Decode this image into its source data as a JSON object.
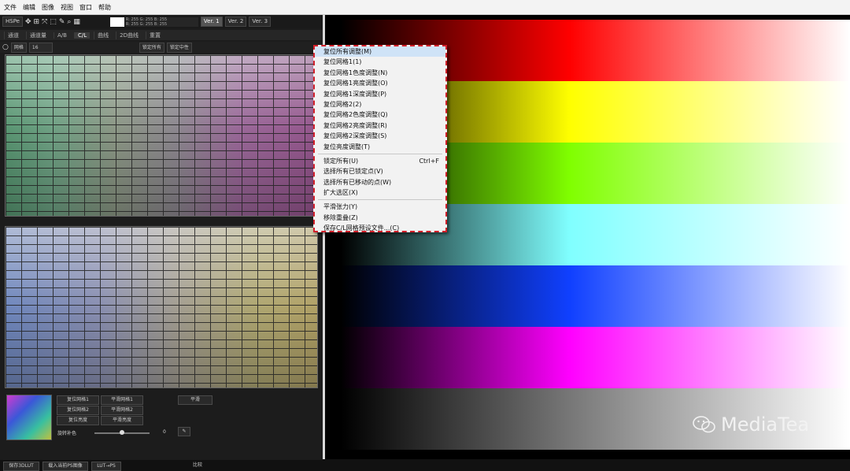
{
  "menubar": [
    "文件",
    "编辑",
    "图像",
    "视图",
    "窗口",
    "帮助"
  ],
  "toolbar": {
    "mode": "HSPe",
    "readout_line1": "R: 255 G: 255 B: 255",
    "readout_line2": "R: 255 G: 255 B: 255",
    "versions": [
      "Ver. 1",
      "Ver. 2",
      "Ver. 3"
    ]
  },
  "tabs": [
    "通道",
    "通道量",
    "A/B",
    "C/L",
    "曲线",
    "2D曲线",
    "重置"
  ],
  "sub": {
    "grid_label": "网格",
    "grid_value": "16",
    "lock_all": "锁定所有",
    "lock_mid": "锁定中性"
  },
  "bottom_buttons": [
    "复位网格1",
    "平滑网格1",
    "平滑",
    "复位网格2",
    "平滑网格2",
    "复位亮度",
    "平滑亮度"
  ],
  "hue_label": "旋转补色",
  "hue_value": "0",
  "footer": [
    "保存3DLUT",
    "载入当前PS图像",
    "LUT→PS",
    "比较"
  ],
  "context_menu": {
    "items": [
      {
        "label": "复位所有调整(M)",
        "highlight": true
      },
      {
        "label": "复位网格1(1)"
      },
      {
        "label": "复位网格1色度调整(N)"
      },
      {
        "label": "复位网格1亮度调整(O)"
      },
      {
        "label": "复位网格1深度调整(P)"
      },
      {
        "label": "复位网格2(2)"
      },
      {
        "label": "复位网格2色度调整(Q)"
      },
      {
        "label": "复位网格2亮度调整(R)"
      },
      {
        "label": "复位网格2深度调整(S)"
      },
      {
        "label": "复位亮度调整(T)"
      },
      {
        "sep": true
      },
      {
        "label": "锁定所有(U)",
        "shortcut": "Ctrl+F"
      },
      {
        "label": "选择所有已锁定点(V)"
      },
      {
        "label": "选择所有已移动的点(W)"
      },
      {
        "label": "扩大选区(X)"
      },
      {
        "sep": true
      },
      {
        "label": "平滑张力(Y)"
      },
      {
        "label": "移除重叠(Z)"
      },
      {
        "label": "保存C/L网格预设文件...(C)"
      }
    ]
  },
  "preview_bars": [
    {
      "name": "red",
      "color": "#ff0000"
    },
    {
      "name": "yellow",
      "color": "#ffff00"
    },
    {
      "name": "green",
      "color": "#80ff00"
    },
    {
      "name": "cyan",
      "color": "#80ffff"
    },
    {
      "name": "blue",
      "color": "#1040ff"
    },
    {
      "name": "magenta",
      "color": "#ff00ff"
    },
    {
      "name": "gray",
      "color": "#ffffff"
    }
  ],
  "watermark": "MediaTea"
}
